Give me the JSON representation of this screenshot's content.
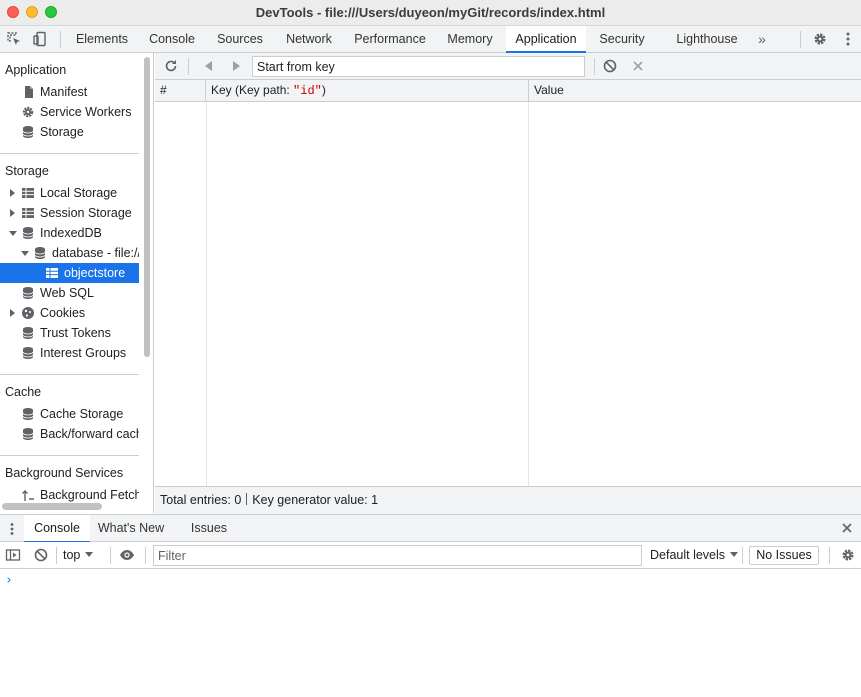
{
  "window": {
    "title": "DevTools - file:///Users/duyeon/myGit/records/index.html"
  },
  "main_tabs": [
    {
      "label": "Elements",
      "active": false
    },
    {
      "label": "Console",
      "active": false
    },
    {
      "label": "Sources",
      "active": false
    },
    {
      "label": "Network",
      "active": false
    },
    {
      "label": "Performance",
      "active": false
    },
    {
      "label": "Memory",
      "active": false
    },
    {
      "label": "Application",
      "active": true
    },
    {
      "label": "Security",
      "active": false
    },
    {
      "label": "Lighthouse",
      "active": false
    }
  ],
  "more_tabs_label": "»",
  "sidebar": {
    "sections": {
      "application": "Application",
      "storage": "Storage",
      "cache": "Cache",
      "background": "Background Services"
    },
    "items": {
      "manifest": "Manifest",
      "service_workers": "Service Workers",
      "storage": "Storage",
      "local_storage": "Local Storage",
      "session_storage": "Session Storage",
      "indexeddb": "IndexedDB",
      "database": "database - file://",
      "objectstore": "objectstore",
      "web_sql": "Web SQL",
      "cookies": "Cookies",
      "trust_tokens": "Trust Tokens",
      "interest_groups": "Interest Groups",
      "cache_storage": "Cache Storage",
      "back_forward_cache": "Back/forward cache",
      "background_fetch": "Background Fetch"
    }
  },
  "content_toolbar": {
    "key_placeholder": "Start from key"
  },
  "table": {
    "col_index": "#",
    "col_key_prefix": "Key (Key path: ",
    "col_key_path": "\"id\"",
    "col_key_suffix": ")",
    "col_value": "Value"
  },
  "footer": {
    "total_entries": "Total entries: 0",
    "key_generator": "Key generator value: 1"
  },
  "drawer": {
    "tabs": [
      {
        "label": "Console",
        "active": true
      },
      {
        "label": "What's New",
        "active": false
      },
      {
        "label": "Issues",
        "active": false
      }
    ],
    "context": "top",
    "filter_placeholder": "Filter",
    "levels": "Default levels",
    "issues_button": "No Issues",
    "prompt": "›"
  },
  "colors": {
    "accent": "#1a73e8",
    "toolbar_bg": "#f1f3f4",
    "border": "#cacdd1",
    "key_path_red": "#c80000"
  }
}
